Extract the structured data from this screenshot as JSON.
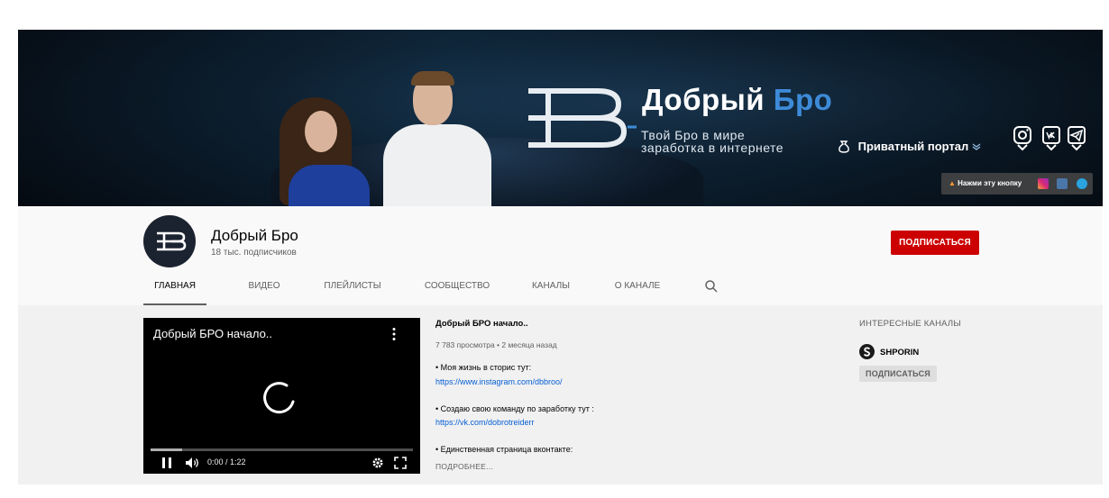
{
  "banner": {
    "title_main": "Добрый",
    "title_accent": "Бро",
    "subtitle_line1": "Твой Бро в мире",
    "subtitle_line2": "заработка в интернете",
    "portal_label": "Приватный портал",
    "hint_text": "Нажми эту кнопку",
    "accent_color": "#3d8bd8",
    "social_icons": [
      "instagram-icon",
      "vk-icon",
      "telegram-icon"
    ]
  },
  "channel": {
    "name": "Добрый Бро",
    "subscribers": "18 тыс. подписчиков",
    "subscribe_label": "ПОДПИСАТЬСЯ",
    "subscribe_color": "#cc0000"
  },
  "tabs": [
    {
      "label": "ГЛАВНАЯ",
      "active": true
    },
    {
      "label": "ВИДЕО",
      "active": false
    },
    {
      "label": "ПЛЕЙЛИСТЫ",
      "active": false
    },
    {
      "label": "СООБЩЕСТВО",
      "active": false
    },
    {
      "label": "КАНАЛЫ",
      "active": false
    },
    {
      "label": "О КАНАЛЕ",
      "active": false
    }
  ],
  "player": {
    "title": "Добрый БРО начало..",
    "time": "0:00 / 1:22",
    "progress_fraction": 0.12
  },
  "video": {
    "title": "Добрый БРО начало..",
    "meta": "7 783 просмотра • 2 месяца назад",
    "desc1": "• Моя жизнь в сторис тут:",
    "link1": "https://www.instagram.com/dbbroo/",
    "desc2": "• Создаю свою команду по заработку тут :",
    "link2": "https://vk.com/dobrotreiderr",
    "desc3": "• Единственная страница вконтакте:",
    "more_label": "ПОДРОБНЕЕ..."
  },
  "sidebar": {
    "heading": "ИНТЕРЕСНЫЕ КАНАЛЫ",
    "channel_name": "SHPORIN",
    "subscribe_label": "ПОДПИСАТЬСЯ"
  }
}
